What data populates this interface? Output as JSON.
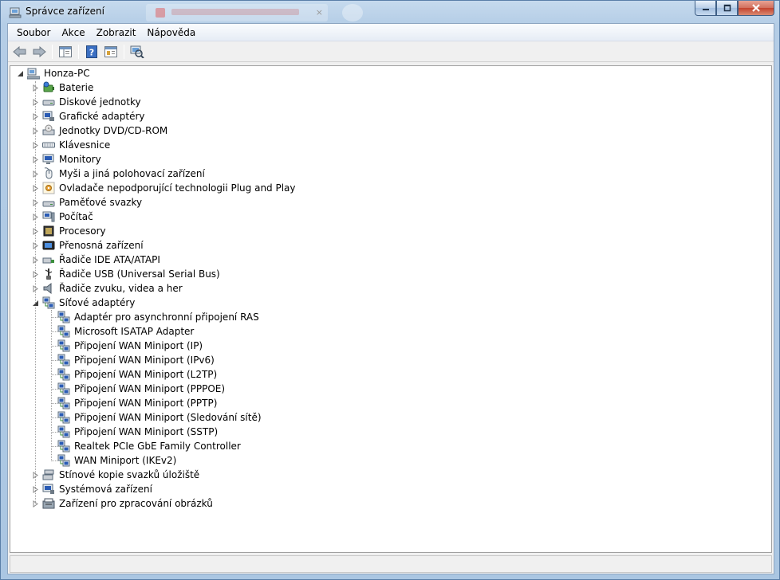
{
  "window": {
    "title": "Správce zařízení",
    "icon": "device-manager-icon",
    "buttons": {
      "minimize": "_",
      "maximize": "□",
      "close": "X"
    }
  },
  "menu": [
    "Soubor",
    "Akce",
    "Zobrazit",
    "Nápověda"
  ],
  "toolbar": [
    "back-icon",
    "forward-icon",
    "console-tree-icon",
    "help-icon",
    "properties-icon",
    "scan-hardware-icon"
  ],
  "tree": {
    "root": "Honza-PC",
    "categories": [
      {
        "label": "Baterie",
        "icon": "battery-icon",
        "expanded": false
      },
      {
        "label": "Diskové jednotky",
        "icon": "disk-drive-icon",
        "expanded": false
      },
      {
        "label": "Grafické adaptéry",
        "icon": "display-adapter-icon",
        "expanded": false
      },
      {
        "label": "Jednotky DVD/CD-ROM",
        "icon": "dvd-drive-icon",
        "expanded": false
      },
      {
        "label": "Klávesnice",
        "icon": "keyboard-icon",
        "expanded": false
      },
      {
        "label": "Monitory",
        "icon": "monitor-icon",
        "expanded": false
      },
      {
        "label": "Myši a jiná polohovací zařízení",
        "icon": "mouse-icon",
        "expanded": false
      },
      {
        "label": "Ovladače nepodporující technologii Plug and Play",
        "icon": "non-pnp-driver-icon",
        "expanded": false
      },
      {
        "label": "Paměťové svazky",
        "icon": "storage-volume-icon",
        "expanded": false
      },
      {
        "label": "Počítač",
        "icon": "computer-icon",
        "expanded": false
      },
      {
        "label": "Procesory",
        "icon": "processor-icon",
        "expanded": false
      },
      {
        "label": "Přenosná zařízení",
        "icon": "portable-device-icon",
        "expanded": false
      },
      {
        "label": "Řadiče IDE ATA/ATAPI",
        "icon": "ide-controller-icon",
        "expanded": false
      },
      {
        "label": "Řadiče USB (Universal Serial Bus)",
        "icon": "usb-icon",
        "expanded": false
      },
      {
        "label": "Řadiče zvuku, videa a her",
        "icon": "speaker-icon",
        "expanded": false
      },
      {
        "label": "Síťové adaptéry",
        "icon": "network-adapter-icon",
        "expanded": true,
        "children": [
          "Adaptér pro asynchronní připojení RAS",
          "Microsoft ISATAP Adapter",
          "Připojení WAN Miniport (IP)",
          "Připojení WAN Miniport (IPv6)",
          "Připojení WAN Miniport (L2TP)",
          "Připojení WAN Miniport (PPPOE)",
          "Připojení WAN Miniport (PPTP)",
          "Připojení WAN Miniport (Sledování sítě)",
          "Připojení WAN Miniport (SSTP)",
          "Realtek PCIe GbE Family Controller",
          "WAN Miniport (IKEv2)"
        ]
      },
      {
        "label": "Stínové kopie svazků úložiště",
        "icon": "shadow-copy-icon",
        "expanded": false
      },
      {
        "label": "Systémová zařízení",
        "icon": "system-device-icon",
        "expanded": false
      },
      {
        "label": "Zařízení pro zpracování obrázků",
        "icon": "imaging-device-icon",
        "expanded": false
      }
    ]
  },
  "colors": {
    "frame": "#b4cde6",
    "close_button": "#c4432e",
    "tree_background": "#ffffff"
  }
}
